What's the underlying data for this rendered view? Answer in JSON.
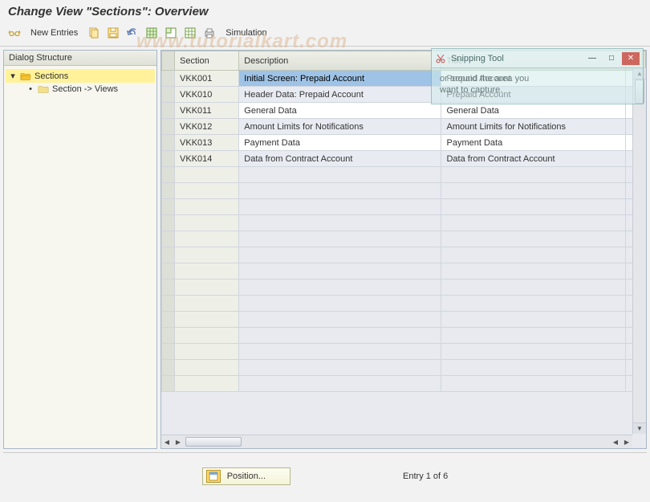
{
  "title": "Change View \"Sections\": Overview",
  "toolbar": {
    "new_entries": "New Entries",
    "simulation": "Simulation"
  },
  "watermark": "www.tutorialkart.com",
  "dialog_structure": {
    "header": "Dialog Structure",
    "root": "Sections",
    "child": "Section -> Views"
  },
  "table": {
    "headers": {
      "section": "Section",
      "description": "Description",
      "title": "Title"
    },
    "rows": [
      {
        "section": "VKK001",
        "description": "Initial Screen: Prepaid Account",
        "title": "Prepaid Account"
      },
      {
        "section": "VKK010",
        "description": "Header Data: Prepaid Account",
        "title": "Prepaid Account"
      },
      {
        "section": "VKK011",
        "description": "General Data",
        "title": "General Data"
      },
      {
        "section": "VKK012",
        "description": "Amount Limits for Notifications",
        "title": "Amount Limits for Notifications"
      },
      {
        "section": "VKK013",
        "description": "Payment Data",
        "title": "Payment Data"
      },
      {
        "section": "VKK014",
        "description": "Data from Contract Account",
        "title": "Data from Contract Account"
      }
    ]
  },
  "footer": {
    "position": "Position...",
    "entry": "Entry 1 of 6"
  },
  "snipping": {
    "title": "Snipping Tool",
    "hint1": "or around the area you",
    "hint2": "want to capture."
  },
  "icons": {
    "glasses": "glasses-icon",
    "copy": "copy-icon",
    "save": "save-icon",
    "undo": "undo-icon",
    "select_all": "select-all-icon",
    "select_block": "select-block-icon",
    "deselect": "deselect-icon",
    "print": "print-icon"
  }
}
